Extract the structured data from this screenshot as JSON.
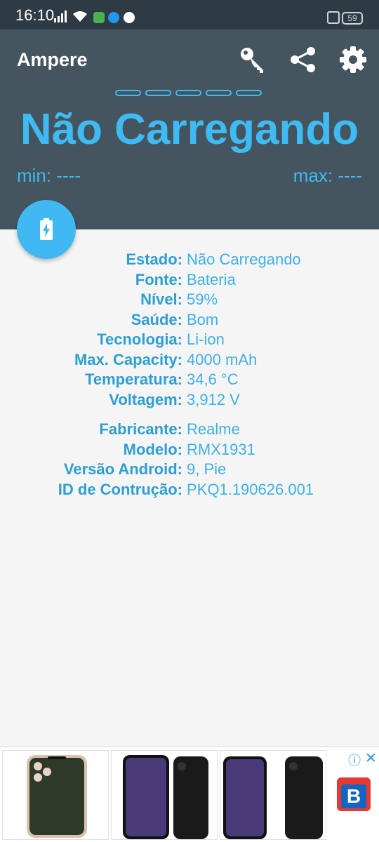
{
  "status_bar": {
    "time": "16:10",
    "battery_level": "59",
    "icons": [
      "signal-icon",
      "wifi-icon",
      "message-app-icon",
      "store-app-icon",
      "maps-app-icon",
      "nfc-icon",
      "battery-icon"
    ]
  },
  "app_bar": {
    "title": "Ampere",
    "actions": [
      "key-icon",
      "share-icon",
      "settings-icon"
    ]
  },
  "charge": {
    "status": "Não Carregando",
    "min_label": "min: ----",
    "max_label": "max: ----",
    "indicator_segments": 5
  },
  "fab": {
    "icon": "battery-charging-icon"
  },
  "battery_info": [
    {
      "label": "Estado:",
      "value": "Não Carregando"
    },
    {
      "label": "Fonte:",
      "value": "Bateria"
    },
    {
      "label": "Nível:",
      "value": "59%"
    },
    {
      "label": "Saúde:",
      "value": "Bom"
    },
    {
      "label": "Tecnologia:",
      "value": "Li-ion"
    },
    {
      "label": "Max. Capacity:",
      "value": "4000 mAh"
    },
    {
      "label": "Temperatura:",
      "value": "34,6 °C"
    },
    {
      "label": "Voltagem:",
      "value": "3,912 V"
    }
  ],
  "device_info": [
    {
      "label": "Fabricante:",
      "value": "Realme"
    },
    {
      "label": "Modelo:",
      "value": "RMX1931"
    },
    {
      "label": "Versão Android:",
      "value": "9, Pie"
    },
    {
      "label": "ID de Contrução:",
      "value": "PKQ1.190626.001"
    }
  ],
  "ad": {
    "info_icon": "ⓘ",
    "close_icon": "✕",
    "logo_letter": "B"
  },
  "colors": {
    "accent": "#3fbaf2",
    "header": "#445560",
    "status_bar": "#2e3b44",
    "label": "#2f9fd2"
  }
}
